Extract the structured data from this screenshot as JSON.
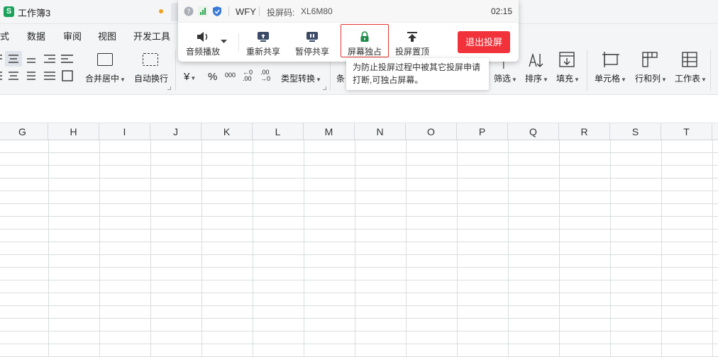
{
  "window": {
    "title": "工作簿3"
  },
  "menu": {
    "items": [
      "式",
      "数据",
      "审阅",
      "视图",
      "开发工具"
    ]
  },
  "ribbon": {
    "merge_label": "合并居中",
    "wrap_label": "自动换行",
    "currency_symbol": "¥",
    "percent_symbol": "%",
    "thousands_symbol": "000",
    "dec_inc": "←0 .00",
    "dec_dec": ".00 →0",
    "type_convert_label": "类型转换",
    "cond_label": "条",
    "filter_label": "筛选",
    "sort_label": "排序",
    "fill_label": "填充",
    "cell_label": "单元格",
    "rowcol_label": "行和列",
    "sheet_label": "工作表"
  },
  "columns": [
    "G",
    "H",
    "I",
    "J",
    "K",
    "L",
    "M",
    "N",
    "O",
    "P",
    "Q",
    "R",
    "S",
    "T"
  ],
  "cast": {
    "user": "WFY",
    "code_label": "投屏码:",
    "code": "XL6M80",
    "time": "02:15",
    "audio_label": "音频播放",
    "reshare_label": "重新共享",
    "pause_label": "暂停共享",
    "lock_label": "屏幕独占",
    "pin_label": "投屏置顶",
    "exit_label": "退出投屏",
    "tooltip": "为防止投屏过程中被其它投屏申请打断,可独占屏幕。",
    "colors": {
      "exit": "#f2323a",
      "highlight": "#e0332c",
      "lock_icon": "#1e8a4a"
    }
  }
}
